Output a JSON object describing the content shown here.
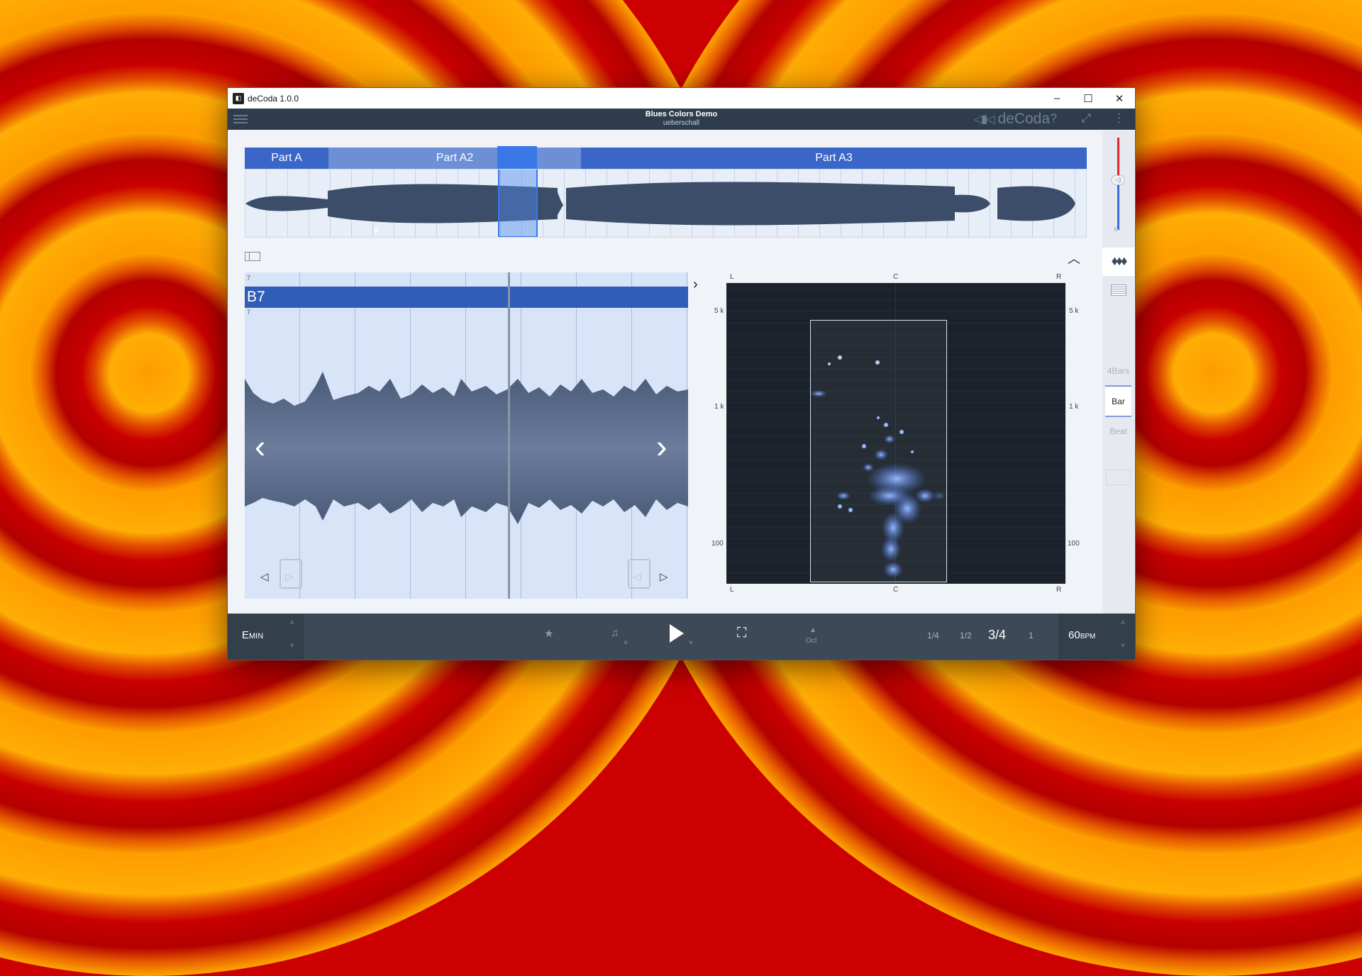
{
  "window": {
    "title": "deCoda 1.0.0",
    "minimize": "–",
    "maximize": "☐",
    "close": "✕"
  },
  "header": {
    "song": "Blues Colors Demo",
    "artist": "ueberschall",
    "brand": "deCoda",
    "help": "?",
    "expand": "⤢",
    "more": "⋮"
  },
  "sections": [
    {
      "label": "Part A"
    },
    {
      "label": "Part A2"
    },
    {
      "label": "Part A3"
    }
  ],
  "waveform": {
    "chord": "B7",
    "marker_top": "7",
    "marker_bottom": "7",
    "prev": "‹",
    "next": "›"
  },
  "spectrum": {
    "top_left": "L",
    "top_center": "C",
    "top_right": "R",
    "bottom_left": "L",
    "bottom_center": "C",
    "bottom_right": "R",
    "freq_labels": [
      "5 k",
      "1 k",
      "100"
    ]
  },
  "sidebar": {
    "resolutions": [
      "4Bars",
      "Bar",
      "Beat"
    ],
    "selected": "Bar"
  },
  "transport": {
    "key_main": "E",
    "key_mode": "MIN",
    "star": "★",
    "metronome": "♫",
    "fit": "⛶",
    "oct_label": "Oct",
    "fractions": [
      "1/4",
      "1/2"
    ],
    "meter": "3/4",
    "count": "1",
    "bpm_value": "60",
    "bpm_unit": "BPM"
  },
  "colors": {
    "accent": "#3a67c7",
    "window_bar": "#2e3c4e",
    "transport": "#3d4957"
  }
}
